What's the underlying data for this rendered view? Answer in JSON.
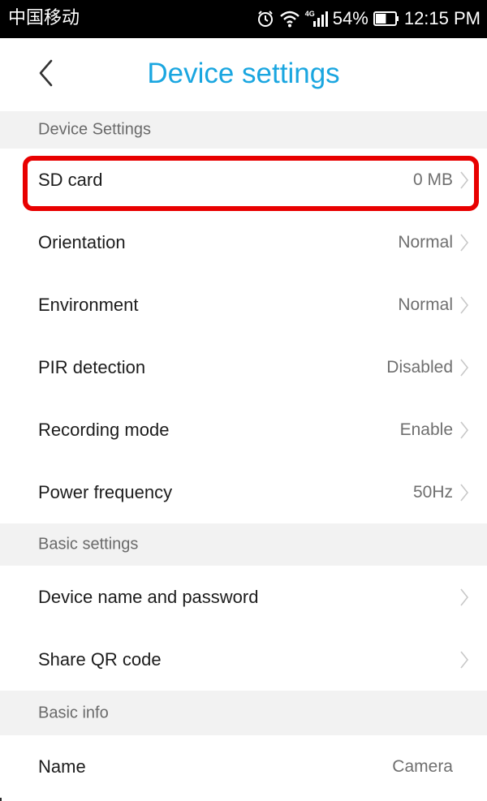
{
  "status_bar": {
    "carrier": "中国移动",
    "network_label": "4G",
    "battery_percent": "54%",
    "battery_level": 0.54,
    "time": "12:15 PM",
    "icons": [
      "alarm-icon",
      "wifi-icon",
      "signal-icon",
      "battery-icon"
    ]
  },
  "header": {
    "title": "Device settings",
    "back_icon": "chevron-left-icon"
  },
  "sections": {
    "device_settings": "Device Settings",
    "basic_settings": "Basic settings",
    "basic_info": "Basic info"
  },
  "device_settings_items": [
    {
      "label": "SD card",
      "value": "0 MB"
    },
    {
      "label": "Orientation",
      "value": "Normal"
    },
    {
      "label": "Environment",
      "value": "Normal"
    },
    {
      "label": "PIR detection",
      "value": "Disabled"
    },
    {
      "label": "Recording mode",
      "value": "Enable"
    },
    {
      "label": "Power frequency",
      "value": "50Hz"
    }
  ],
  "basic_settings_items": [
    {
      "label": "Device name and password"
    },
    {
      "label": "Share QR code"
    }
  ],
  "basic_info_items": [
    {
      "label": "Name",
      "value": "Camera"
    }
  ],
  "colors": {
    "accent": "#1aa6e0",
    "highlight": "#e80000",
    "section_bg": "#f2f2f2"
  }
}
